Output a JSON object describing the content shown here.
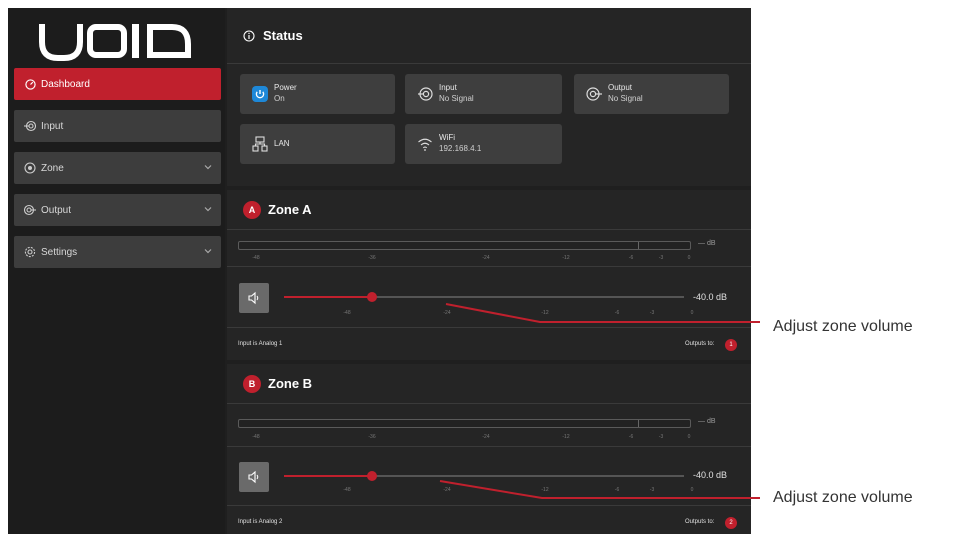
{
  "brand": {
    "logo_text": "VOID",
    "accent": "#c0202d"
  },
  "sidebar": {
    "items": [
      {
        "label": "Dashboard",
        "icon": "dashboard-gauge-icon",
        "active": true,
        "expandable": false
      },
      {
        "label": "Input",
        "icon": "input-icon",
        "active": false,
        "expandable": false
      },
      {
        "label": "Zone",
        "icon": "zone-icon",
        "active": false,
        "expandable": true
      },
      {
        "label": "Output",
        "icon": "output-icon",
        "active": false,
        "expandable": true
      },
      {
        "label": "Settings",
        "icon": "gear-icon",
        "active": false,
        "expandable": true
      }
    ]
  },
  "status": {
    "title": "Status",
    "cards": {
      "power": {
        "title": "Power",
        "value": "On"
      },
      "input": {
        "title": "Input",
        "value": "No Signal"
      },
      "output": {
        "title": "Output",
        "value": "No Signal"
      },
      "lan": {
        "title": "LAN"
      },
      "wifi": {
        "title": "WiFi",
        "value": "192.168.4.1"
      }
    }
  },
  "zones": [
    {
      "badge": "A",
      "title": "Zone A",
      "meter_readout": "— dB",
      "meter_ticks": [
        "-48",
        "-36",
        "-24",
        "-12",
        "-6",
        "-3",
        "0"
      ],
      "volume_db": -40,
      "volume_level": 0.22,
      "volume_readout": "-40.0 dB",
      "slider_ticks": [
        "-48",
        "-24",
        "-12",
        "-6",
        "-3",
        "0"
      ],
      "input_label": "Input is Analog 1",
      "outputs_label": "Outputs to:",
      "output_number": "1"
    },
    {
      "badge": "B",
      "title": "Zone B",
      "meter_readout": "— dB",
      "meter_ticks": [
        "-48",
        "-36",
        "-24",
        "-12",
        "-6",
        "-3",
        "0"
      ],
      "volume_db": -40,
      "volume_level": 0.22,
      "volume_readout": "-40.0 dB",
      "slider_ticks": [
        "-48",
        "-24",
        "-12",
        "-6",
        "-3",
        "0"
      ],
      "input_label": "Input is Analog 2",
      "outputs_label": "Outputs to:",
      "output_number": "2"
    }
  ],
  "annotations": [
    {
      "label": "Adjust zone volume"
    },
    {
      "label": "Adjust zone volume"
    }
  ]
}
